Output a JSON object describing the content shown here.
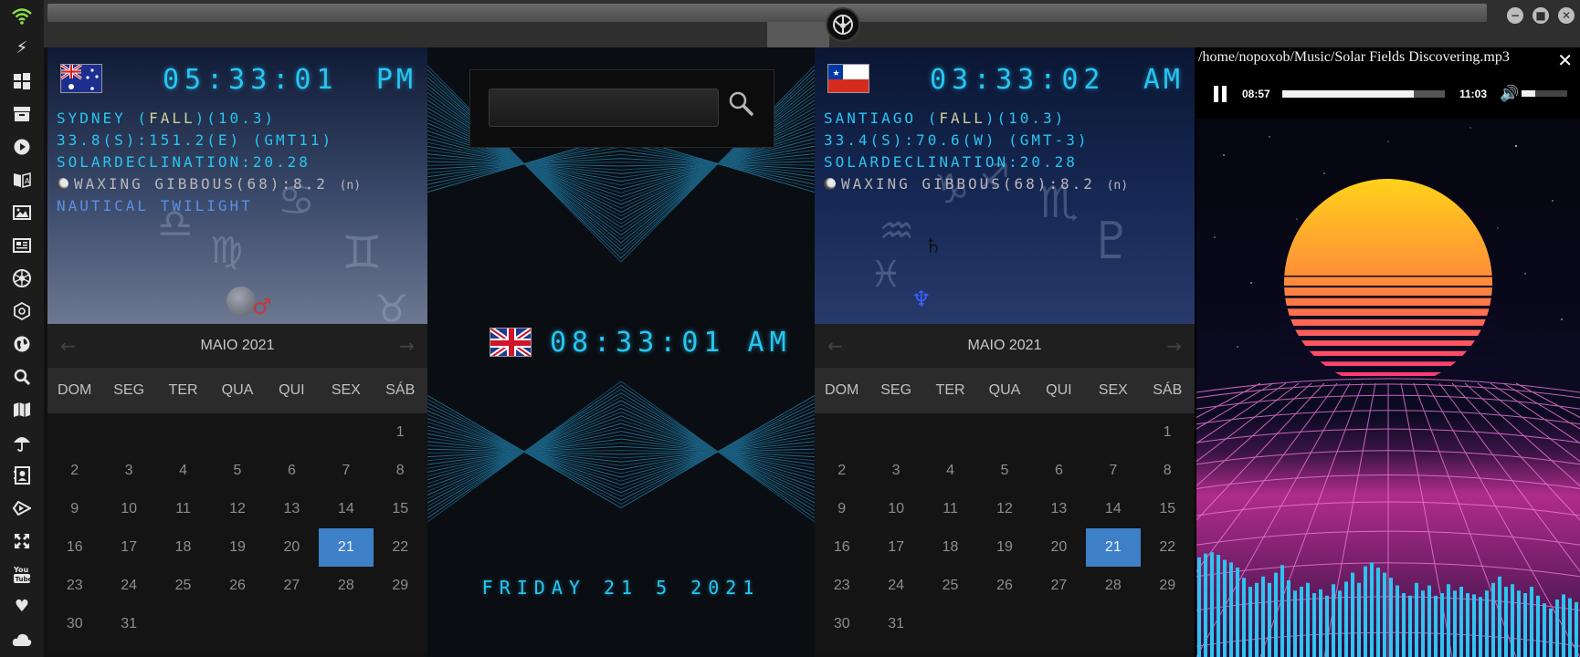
{
  "sidebar": {
    "icons": [
      "wifi-icon",
      "lightning-icon",
      "windows-icon",
      "inbox-icon",
      "play-icon",
      "translate-icon",
      "image-icon",
      "news-icon",
      "rebel-alliance-icon",
      "steam-icon",
      "globe-icon",
      "search-icon",
      "map-icon",
      "umbrella-icon",
      "contacts-icon",
      "bandcamp-icon",
      "fullscreen-icon",
      "youtube-icon",
      "heart-icon",
      "cloud-icon"
    ]
  },
  "titlebar": {
    "emblem": "rebel-alliance-icon",
    "buttons": [
      "minimize-icon",
      "maximize-icon",
      "close-icon"
    ]
  },
  "sydney": {
    "flag": "australia-flag-icon",
    "time": "05:33:01",
    "ampm": "PM",
    "line1_prefix": "SYDNEY (",
    "line1_season": "FALL",
    "line1_suffix": ")(10.3)",
    "line2": "33.8(S):151.2(E) (GMT11)",
    "line3": "SOLARDECLINATION:20.28",
    "line4": "WAXING GIBBOUS(68):8.2",
    "line4_hem": "(n)",
    "line5": "NAUTICAL TWILIGHT"
  },
  "santiago": {
    "flag": "chile-flag-icon",
    "time": "03:33:02",
    "ampm": "AM",
    "line1_prefix": "SANTIAGO (",
    "line1_season": "FALL",
    "line1_suffix": ")(10.3)",
    "line2": "33.4(S):70.6(W) (GMT-3)",
    "line3": "SOLARDECLINATION:20.28",
    "line4": "WAXING GIBBOUS(68):8.2",
    "line4_hem": "(n)"
  },
  "calendar": {
    "month": "MAIO 2021",
    "weekdays": [
      "DOM",
      "SEG",
      "TER",
      "QUA",
      "QUI",
      "SEX",
      "SÁB"
    ],
    "weeks": [
      [
        "",
        "",
        "",
        "",
        "",
        "",
        "1"
      ],
      [
        "2",
        "3",
        "4",
        "5",
        "6",
        "7",
        "8"
      ],
      [
        "9",
        "10",
        "11",
        "12",
        "13",
        "14",
        "15"
      ],
      [
        "16",
        "17",
        "18",
        "19",
        "20",
        "21",
        "22"
      ],
      [
        "23",
        "24",
        "25",
        "26",
        "27",
        "28",
        "29"
      ],
      [
        "30",
        "31",
        "",
        "",
        "",
        "",
        ""
      ]
    ],
    "today": "21"
  },
  "center": {
    "search_value": "",
    "search_icon": "magnifier-icon",
    "flag": "uk-flag-icon",
    "time": "08:33:01 AM",
    "date": "FRIDAY 21 5 2021"
  },
  "player": {
    "path": "/home/nopoxob/Music/Solar Fields Discovering.mp3",
    "close_icon": "close-icon",
    "current_time": "08:57",
    "duration": "11:03",
    "progress": 0.81,
    "volume": 0.3,
    "play_state": "playing",
    "pause_icon": "pause-icon",
    "volume_icon": "speaker-icon",
    "spectrum": [
      0.78,
      0.81,
      0.82,
      0.8,
      0.76,
      0.74,
      0.7,
      0.62,
      0.55,
      0.58,
      0.63,
      0.58,
      0.66,
      0.72,
      0.6,
      0.52,
      0.55,
      0.58,
      0.5,
      0.53,
      0.48,
      0.57,
      0.52,
      0.59,
      0.66,
      0.58,
      0.71,
      0.74,
      0.7,
      0.66,
      0.62,
      0.56,
      0.5,
      0.48,
      0.58,
      0.52,
      0.56,
      0.48,
      0.5,
      0.57,
      0.52,
      0.55,
      0.5,
      0.49,
      0.47,
      0.52,
      0.58,
      0.63,
      0.55,
      0.57,
      0.52,
      0.5,
      0.55,
      0.48,
      0.42,
      0.38,
      0.45,
      0.49,
      0.46,
      0.43
    ],
    "colors": {
      "bars": "#2ec4ef",
      "sun_top": "#ffd21a",
      "sun_bottom": "#ff2f7d"
    }
  }
}
